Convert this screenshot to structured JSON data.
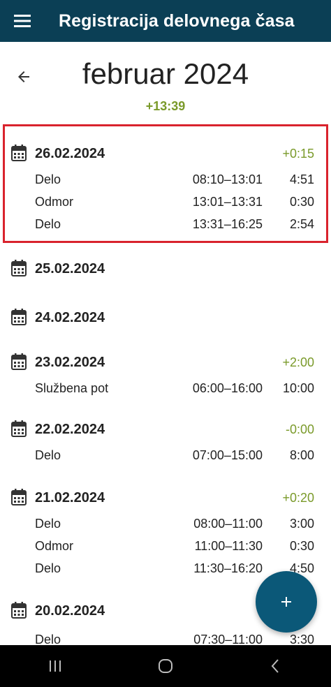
{
  "appbar": {
    "title": "Registracija delovnega časa",
    "menu_icon": "hamburger-menu-icon"
  },
  "month": {
    "title": "februar 2024",
    "total": "+13:39"
  },
  "days": [
    {
      "date": "26.02.2024",
      "diff": "+0:15",
      "highlight": true,
      "entries": [
        {
          "type": "Delo",
          "range": "08:10–13:01",
          "duration": "4:51"
        },
        {
          "type": "Odmor",
          "range": "13:01–13:31",
          "duration": "0:30"
        },
        {
          "type": "Delo",
          "range": "13:31–16:25",
          "duration": "2:54"
        }
      ]
    },
    {
      "date": "25.02.2024",
      "diff": "",
      "entries": []
    },
    {
      "date": "24.02.2024",
      "diff": "",
      "entries": []
    },
    {
      "date": "23.02.2024",
      "diff": "+2:00",
      "entries": [
        {
          "type": "Službena pot",
          "range": "06:00–16:00",
          "duration": "10:00"
        }
      ]
    },
    {
      "date": "22.02.2024",
      "diff": "-0:00",
      "entries": [
        {
          "type": "Delo",
          "range": "07:00–15:00",
          "duration": "8:00"
        }
      ]
    },
    {
      "date": "21.02.2024",
      "diff": "+0:20",
      "entries": [
        {
          "type": "Delo",
          "range": "08:00–11:00",
          "duration": "3:00"
        },
        {
          "type": "Odmor",
          "range": "11:00–11:30",
          "duration": "0:30"
        },
        {
          "type": "Delo",
          "range": "11:30–16:20",
          "duration": "4:50"
        }
      ]
    },
    {
      "date": "20.02.2024",
      "diff": "",
      "entries": [
        {
          "type": "Delo",
          "range": "07:30–11:00",
          "duration": "3:30"
        }
      ]
    }
  ],
  "colors": {
    "appbar": "#0b3f55",
    "positive": "#7a9a2a",
    "fab": "#0b5878",
    "highlight_border": "#d9232d"
  }
}
